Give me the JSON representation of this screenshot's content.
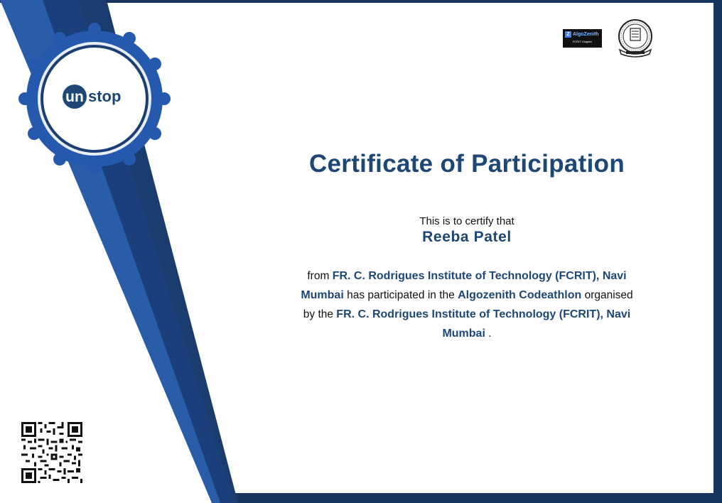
{
  "certificate": {
    "title": "Certificate of Participation",
    "intro": "This is to certify that",
    "recipient": "Reeba Patel",
    "body": {
      "part1": "from ",
      "institute_from": "FR. C. Rodrigues Institute of Technology (FCRIT), Navi Mumbai",
      "part2": " has participated in the ",
      "event": "Algozenith Codeathlon",
      "part3": " organised by the ",
      "organiser": "FR. C. Rodrigues Institute of Technology (FCRIT), Navi Mumbai",
      "part4": " ."
    }
  },
  "logos": {
    "unstop": {
      "un": "un",
      "stop": "stop"
    },
    "algozenith": {
      "mark": "Z",
      "name": "AlgoZenith",
      "sub": "FCRIT Chapter"
    }
  },
  "colors": {
    "primary_blue": "#1d4776",
    "ribbon_blue": "#2a5da8",
    "ribbon_dark": "#1a3f7a",
    "frame_dark": "#17365f"
  },
  "icons": [
    "unstop-logo",
    "algozenith-logo",
    "college-seal-icon",
    "qr-code-icon"
  ]
}
